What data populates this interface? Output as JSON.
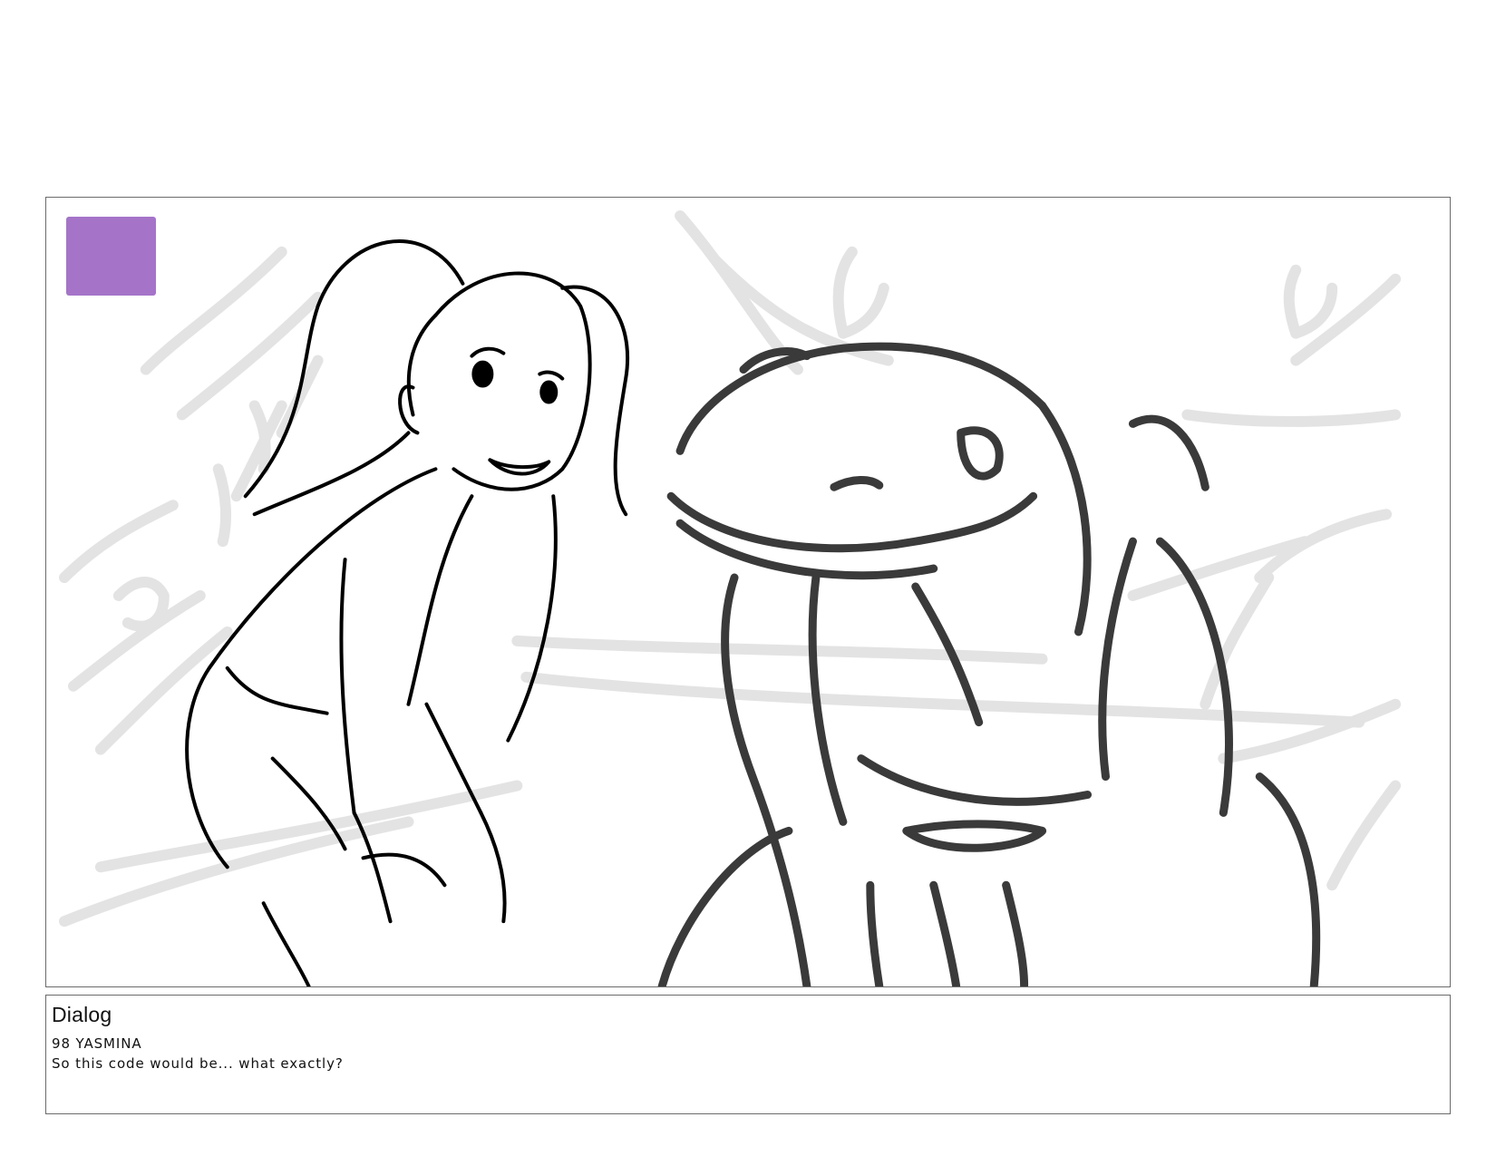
{
  "panel": {
    "marker_color": "#a574c9",
    "background_sketch_color": "#e3e3e3",
    "character_line_color": "#000000",
    "creature_line_color": "#3a3a3a",
    "characters": [
      "girl-with-ponytail",
      "reptile-creature"
    ]
  },
  "dialog": {
    "heading": "Dialog",
    "speaker_line": "98 YASMINA",
    "text": "So this code would be... what exactly?"
  }
}
